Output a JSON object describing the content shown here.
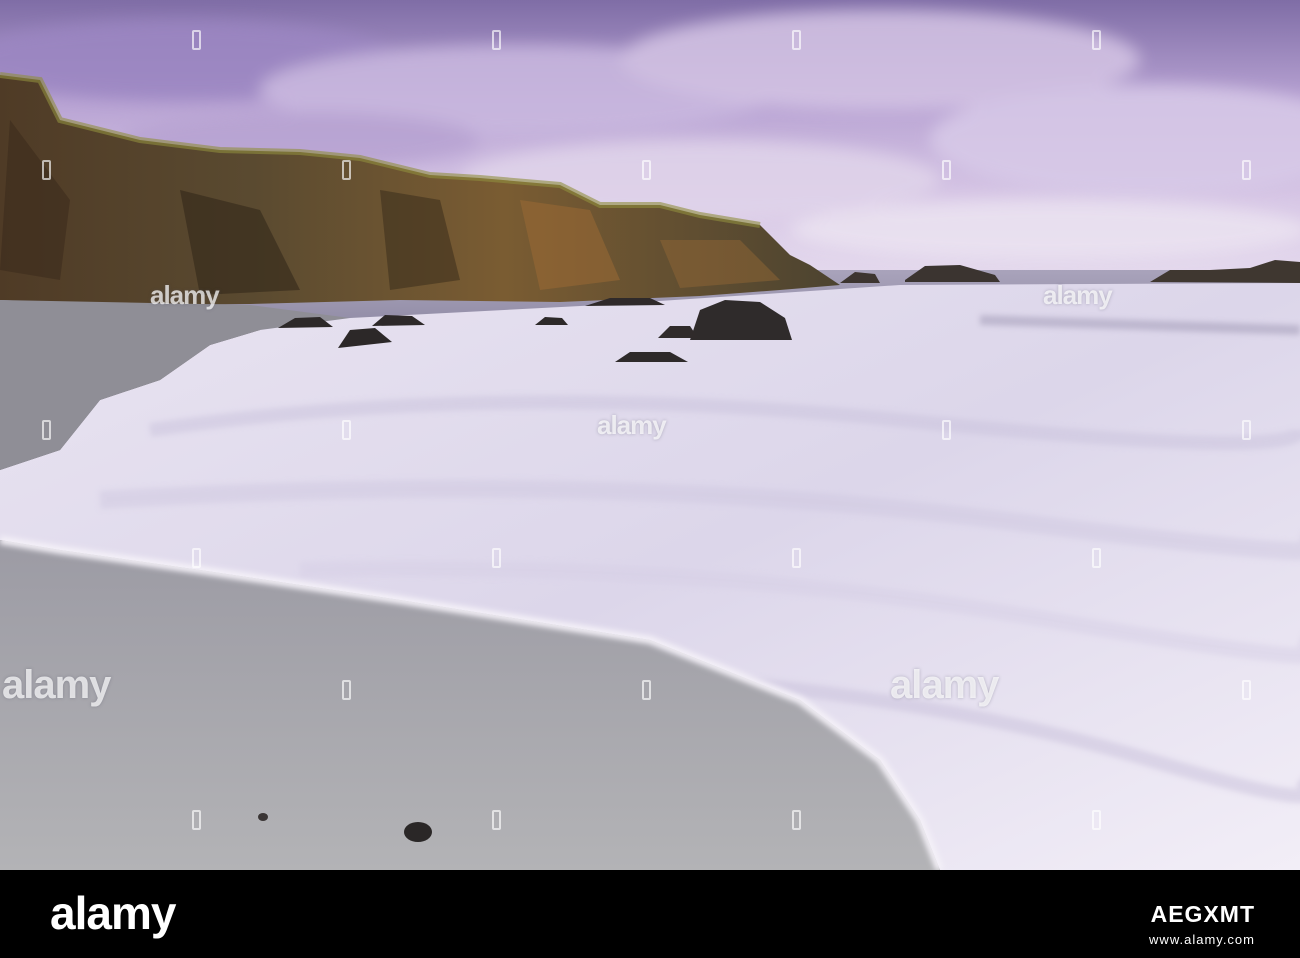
{
  "watermark": {
    "text": "alamy"
  },
  "footer": {
    "logo": "alamy",
    "image_id": "AEGXMT",
    "url": "www.alamy.com"
  },
  "colors": {
    "sky": "#b9a6d6",
    "cliff": "#6b5a3a",
    "surf": "#ece8f4",
    "sand": "#a9a8ad"
  }
}
